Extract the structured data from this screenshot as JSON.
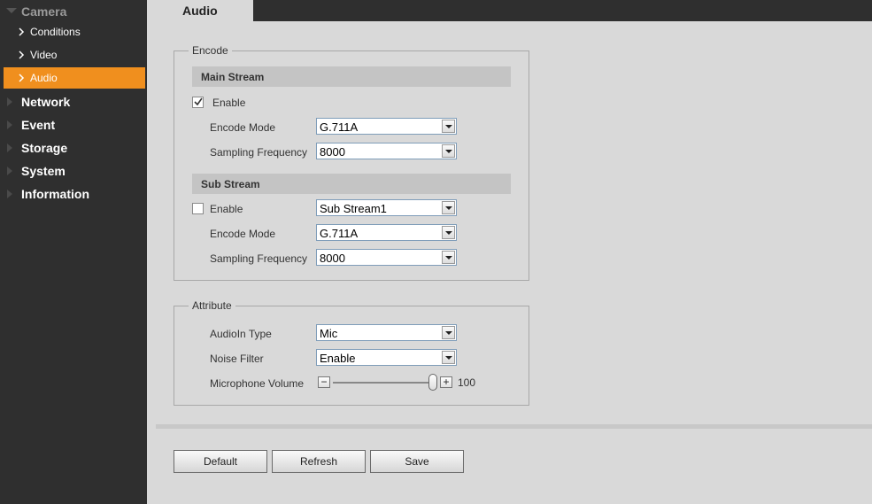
{
  "sidebar": {
    "categories": [
      {
        "label": "Camera"
      },
      {
        "label": "Network"
      },
      {
        "label": "Event"
      },
      {
        "label": "Storage"
      },
      {
        "label": "System"
      },
      {
        "label": "Information"
      }
    ],
    "camera_items": [
      {
        "label": "Conditions"
      },
      {
        "label": "Video"
      },
      {
        "label": "Audio"
      }
    ],
    "active_item": "Audio"
  },
  "header": {
    "tab_label": "Audio"
  },
  "encode": {
    "legend": "Encode",
    "main_stream": {
      "title": "Main Stream",
      "enable_label": "Enable",
      "enabled": true,
      "encode_mode_label": "Encode Mode",
      "encode_mode": "G.711A",
      "sampling_label": "Sampling Frequency",
      "sampling": "8000"
    },
    "sub_stream": {
      "title": "Sub Stream",
      "enable_label": "Enable",
      "enabled": false,
      "stream_select": "Sub Stream1",
      "encode_mode_label": "Encode Mode",
      "encode_mode": "G.711A",
      "sampling_label": "Sampling Frequency",
      "sampling": "8000"
    }
  },
  "attribute": {
    "legend": "Attribute",
    "audioin_label": "AudioIn Type",
    "audioin": "Mic",
    "noise_label": "Noise Filter",
    "noise": "Enable",
    "volume_label": "Microphone Volume",
    "volume_value": "100",
    "volume_fraction": 1.0,
    "minus_glyph": "−",
    "plus_glyph": "+"
  },
  "buttons": {
    "default_label": "Default",
    "refresh_label": "Refresh",
    "save_label": "Save"
  },
  "colors": {
    "accent": "#f08f1e",
    "sidebar_bg": "#2f2f2f",
    "content_bg": "#d9d9d9"
  }
}
